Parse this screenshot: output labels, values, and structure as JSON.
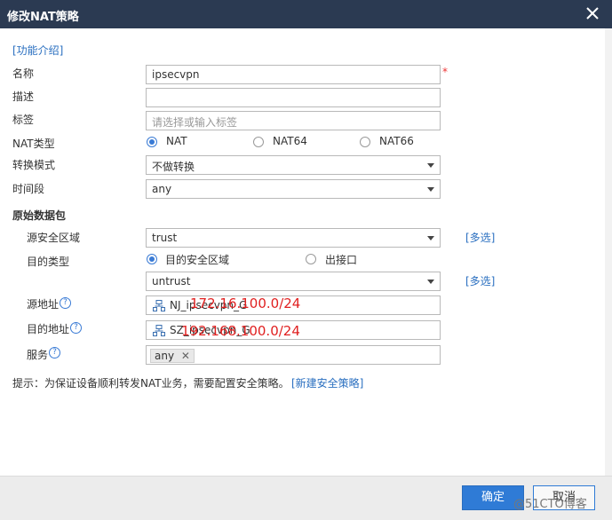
{
  "dialog": {
    "title": "修改NAT策略"
  },
  "help_link": "[功能介绍]",
  "fields": {
    "name": {
      "label": "名称",
      "value": "ipsecvpn",
      "required_mark": "*"
    },
    "desc": {
      "label": "描述",
      "value": ""
    },
    "tag": {
      "label": "标签",
      "placeholder": "请选择或输入标签"
    },
    "nat_type": {
      "label": "NAT类型",
      "options": [
        "NAT",
        "NAT64",
        "NAT66"
      ],
      "selected": "NAT"
    },
    "mode": {
      "label": "转换模式",
      "value": "不做转换"
    },
    "time": {
      "label": "时间段",
      "value": "any"
    }
  },
  "original_packet": {
    "section_label": "原始数据包",
    "src_zone": {
      "label": "源安全区域",
      "value": "trust",
      "multi_link": "[多选]"
    },
    "dst_type": {
      "label": "目的类型",
      "options": [
        "目的安全区域",
        "出接口"
      ],
      "selected": "目的安全区域"
    },
    "dst_zone": {
      "value": "untrust",
      "multi_link": "[多选]"
    },
    "src_addr": {
      "label": "源地址",
      "object": "NJ_ipsecvpn_G",
      "annotation": "172.16.100.0/24"
    },
    "dst_addr": {
      "label": "目的地址",
      "object": "SZ_ipsecvpn_G",
      "annotation": "192.168.100.0/24"
    },
    "service": {
      "label": "服务",
      "chip": "any"
    }
  },
  "tip": {
    "text": "提示：为保证设备顺利转发NAT业务，需要配置安全策略。",
    "link": "[新建安全策略]"
  },
  "buttons": {
    "ok": "确定",
    "cancel": "取消"
  },
  "watermark": "@51CTO博客",
  "colors": {
    "titlebar": "#2b3a52",
    "accent": "#2f7bd6",
    "annotation": "#e02020",
    "required": "#e33333"
  }
}
